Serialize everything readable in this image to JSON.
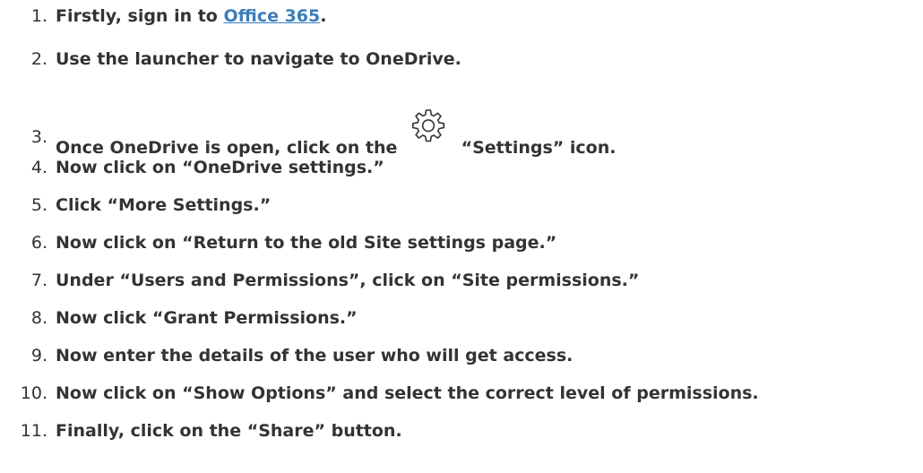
{
  "steps": [
    {
      "number": "1.",
      "before": "Firstly, sign in to ",
      "link": "Office 365",
      "after": "."
    },
    {
      "number": "2.",
      "text": "Use the launcher to navigate to OneDrive."
    },
    {
      "number": "3.",
      "before": "Once OneDrive is open, click on the ",
      "icon": "gear-icon",
      "after": " “Settings” icon."
    },
    {
      "number": "4.",
      "text": "Now click on “OneDrive settings.”"
    },
    {
      "number": "5.",
      "text": "Click “More Settings.”"
    },
    {
      "number": "6.",
      "text": "Now click on “Return to the old Site settings page.”"
    },
    {
      "number": "7.",
      "text": "Under “Users and Permissions”, click on “Site permissions.”"
    },
    {
      "number": "8.",
      "text": "Now click “Grant Permissions.”"
    },
    {
      "number": "9.",
      "text": "Now enter the details of the user who will get access."
    },
    {
      "number": "10.",
      "text": "Now click on “Show Options” and select the correct level of permissions."
    },
    {
      "number": "11.",
      "text": "Finally, click on the “Share” button."
    }
  ],
  "colors": {
    "text": "#333333",
    "link": "#3a7dbb"
  }
}
